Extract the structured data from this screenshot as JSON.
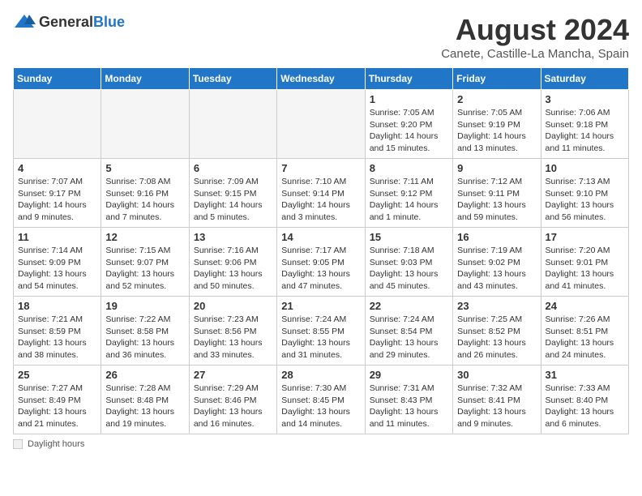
{
  "logo": {
    "general": "General",
    "blue": "Blue"
  },
  "title": "August 2024",
  "location": "Canete, Castille-La Mancha, Spain",
  "days_of_week": [
    "Sunday",
    "Monday",
    "Tuesday",
    "Wednesday",
    "Thursday",
    "Friday",
    "Saturday"
  ],
  "footer": {
    "label": "Daylight hours"
  },
  "weeks": [
    [
      {
        "day": null,
        "empty": true
      },
      {
        "day": null,
        "empty": true
      },
      {
        "day": null,
        "empty": true
      },
      {
        "day": null,
        "empty": true
      },
      {
        "day": 1,
        "sunrise": "7:05 AM",
        "sunset": "9:20 PM",
        "daylight": "14 hours and 15 minutes."
      },
      {
        "day": 2,
        "sunrise": "7:05 AM",
        "sunset": "9:19 PM",
        "daylight": "14 hours and 13 minutes."
      },
      {
        "day": 3,
        "sunrise": "7:06 AM",
        "sunset": "9:18 PM",
        "daylight": "14 hours and 11 minutes."
      }
    ],
    [
      {
        "day": 4,
        "sunrise": "7:07 AM",
        "sunset": "9:17 PM",
        "daylight": "14 hours and 9 minutes."
      },
      {
        "day": 5,
        "sunrise": "7:08 AM",
        "sunset": "9:16 PM",
        "daylight": "14 hours and 7 minutes."
      },
      {
        "day": 6,
        "sunrise": "7:09 AM",
        "sunset": "9:15 PM",
        "daylight": "14 hours and 5 minutes."
      },
      {
        "day": 7,
        "sunrise": "7:10 AM",
        "sunset": "9:14 PM",
        "daylight": "14 hours and 3 minutes."
      },
      {
        "day": 8,
        "sunrise": "7:11 AM",
        "sunset": "9:12 PM",
        "daylight": "14 hours and 1 minute."
      },
      {
        "day": 9,
        "sunrise": "7:12 AM",
        "sunset": "9:11 PM",
        "daylight": "13 hours and 59 minutes."
      },
      {
        "day": 10,
        "sunrise": "7:13 AM",
        "sunset": "9:10 PM",
        "daylight": "13 hours and 56 minutes."
      }
    ],
    [
      {
        "day": 11,
        "sunrise": "7:14 AM",
        "sunset": "9:09 PM",
        "daylight": "13 hours and 54 minutes."
      },
      {
        "day": 12,
        "sunrise": "7:15 AM",
        "sunset": "9:07 PM",
        "daylight": "13 hours and 52 minutes."
      },
      {
        "day": 13,
        "sunrise": "7:16 AM",
        "sunset": "9:06 PM",
        "daylight": "13 hours and 50 minutes."
      },
      {
        "day": 14,
        "sunrise": "7:17 AM",
        "sunset": "9:05 PM",
        "daylight": "13 hours and 47 minutes."
      },
      {
        "day": 15,
        "sunrise": "7:18 AM",
        "sunset": "9:03 PM",
        "daylight": "13 hours and 45 minutes."
      },
      {
        "day": 16,
        "sunrise": "7:19 AM",
        "sunset": "9:02 PM",
        "daylight": "13 hours and 43 minutes."
      },
      {
        "day": 17,
        "sunrise": "7:20 AM",
        "sunset": "9:01 PM",
        "daylight": "13 hours and 41 minutes."
      }
    ],
    [
      {
        "day": 18,
        "sunrise": "7:21 AM",
        "sunset": "8:59 PM",
        "daylight": "13 hours and 38 minutes."
      },
      {
        "day": 19,
        "sunrise": "7:22 AM",
        "sunset": "8:58 PM",
        "daylight": "13 hours and 36 minutes."
      },
      {
        "day": 20,
        "sunrise": "7:23 AM",
        "sunset": "8:56 PM",
        "daylight": "13 hours and 33 minutes."
      },
      {
        "day": 21,
        "sunrise": "7:24 AM",
        "sunset": "8:55 PM",
        "daylight": "13 hours and 31 minutes."
      },
      {
        "day": 22,
        "sunrise": "7:24 AM",
        "sunset": "8:54 PM",
        "daylight": "13 hours and 29 minutes."
      },
      {
        "day": 23,
        "sunrise": "7:25 AM",
        "sunset": "8:52 PM",
        "daylight": "13 hours and 26 minutes."
      },
      {
        "day": 24,
        "sunrise": "7:26 AM",
        "sunset": "8:51 PM",
        "daylight": "13 hours and 24 minutes."
      }
    ],
    [
      {
        "day": 25,
        "sunrise": "7:27 AM",
        "sunset": "8:49 PM",
        "daylight": "13 hours and 21 minutes."
      },
      {
        "day": 26,
        "sunrise": "7:28 AM",
        "sunset": "8:48 PM",
        "daylight": "13 hours and 19 minutes."
      },
      {
        "day": 27,
        "sunrise": "7:29 AM",
        "sunset": "8:46 PM",
        "daylight": "13 hours and 16 minutes."
      },
      {
        "day": 28,
        "sunrise": "7:30 AM",
        "sunset": "8:45 PM",
        "daylight": "13 hours and 14 minutes."
      },
      {
        "day": 29,
        "sunrise": "7:31 AM",
        "sunset": "8:43 PM",
        "daylight": "13 hours and 11 minutes."
      },
      {
        "day": 30,
        "sunrise": "7:32 AM",
        "sunset": "8:41 PM",
        "daylight": "13 hours and 9 minutes."
      },
      {
        "day": 31,
        "sunrise": "7:33 AM",
        "sunset": "8:40 PM",
        "daylight": "13 hours and 6 minutes."
      }
    ]
  ]
}
